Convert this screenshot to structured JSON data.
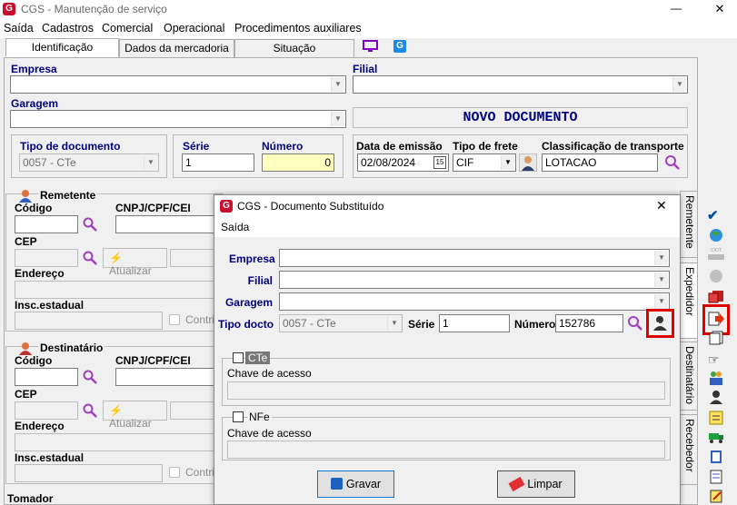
{
  "window": {
    "title": "CGS - Manutenção de serviço",
    "minimize": "—",
    "maximize": "☐",
    "close": "✕"
  },
  "menu": [
    "Saída",
    "Cadastros",
    "Comercial",
    "Operacional",
    "Procedimentos auxiliares"
  ],
  "tabs": [
    "Identificação",
    "Dados da mercadoria",
    "Situação"
  ],
  "form": {
    "empresa_label": "Empresa",
    "filial_label": "Filial",
    "garagem_label": "Garagem",
    "status": "NOVO DOCUMENTO",
    "tipo_doc_label": "Tipo de documento",
    "tipo_doc_value": "0057 - CTe",
    "serie_label": "Série",
    "serie_value": "1",
    "numero_label": "Número",
    "numero_value": "0",
    "data_emissao_label": "Data de emissão",
    "data_emissao_value": "02/08/2024",
    "tipo_frete_label": "Tipo de frete",
    "tipo_frete_value": "CIF",
    "classif_label": "Classificação de transporte",
    "classif_value": "LOTACAO"
  },
  "remetente": {
    "title": "Remetente",
    "codigo": "Código",
    "cnpj": "CNPJ/CPF/CEI",
    "cep": "CEP",
    "atualizar": "Atualizar",
    "endereco": "Endereço",
    "insc": "Insc.estadual",
    "contrib": "Contrib"
  },
  "destinatario": {
    "title": "Destinatário",
    "codigo": "Código",
    "cnpj": "CNPJ/CPF/CEI",
    "cep": "CEP",
    "atualizar": "Atualizar",
    "endereco": "Endereço",
    "insc": "Insc.estadual",
    "contrib": "Contrib"
  },
  "tomador": "Tomador",
  "side_tabs": [
    "Remetente",
    "Expedidor",
    "Destinatário",
    "Recebedor"
  ],
  "dialog": {
    "title": "CGS - Documento Substituído",
    "menu": "Saída",
    "empresa": "Empresa",
    "filial": "Filial",
    "garagem": "Garagem",
    "tipo_docto": "Tipo docto",
    "tipo_docto_value": "0057 - CTe",
    "serie": "Série",
    "serie_value": "1",
    "numero": "Número",
    "numero_value": "152786",
    "cte_label": "CTe",
    "cte_chave": "Chave de acesso",
    "nfe_label": "NFe",
    "nfe_chave": "Chave de acesso",
    "gravar": "Gravar",
    "limpar": "Limpar",
    "close": "✕"
  },
  "colors": {
    "accent_red": "#e00000",
    "navy": "#000080",
    "status": "#000080",
    "highlight": "#ffffc0"
  }
}
